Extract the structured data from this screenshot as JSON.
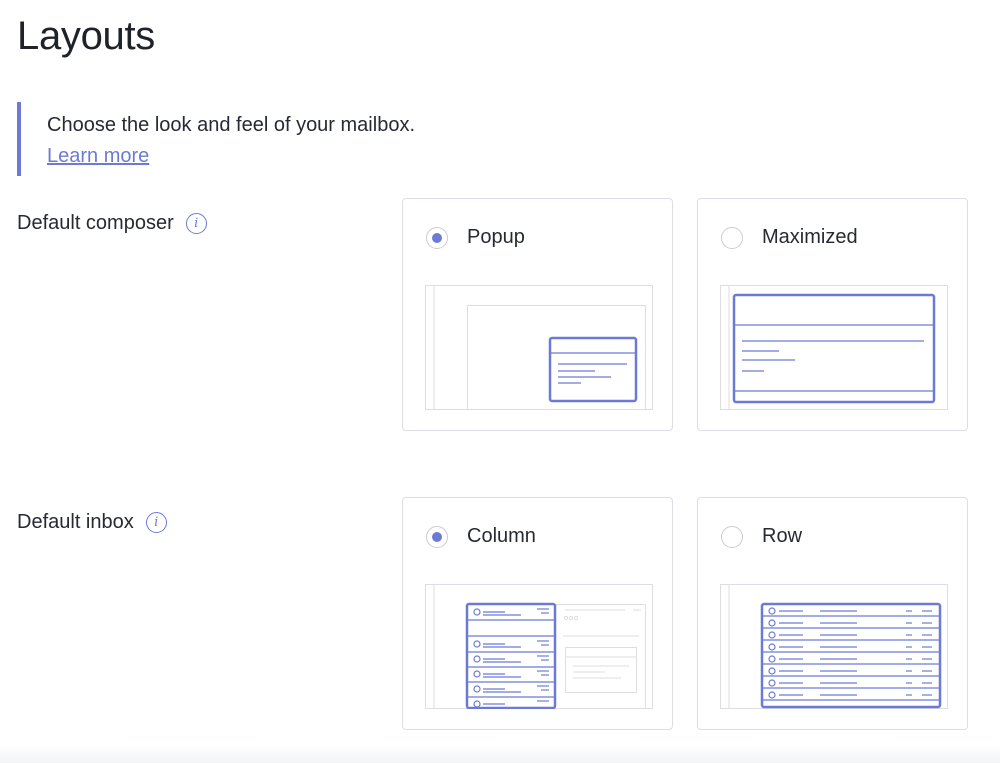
{
  "page": {
    "title": "Layouts"
  },
  "info": {
    "description": "Choose the look and feel of your mailbox.",
    "link_label": "Learn more"
  },
  "settings": {
    "composer": {
      "label": "Default composer",
      "info_icon": "i",
      "options": [
        {
          "label": "Popup",
          "selected": true
        },
        {
          "label": "Maximized",
          "selected": false
        }
      ]
    },
    "inbox": {
      "label": "Default inbox",
      "info_icon": "i",
      "options": [
        {
          "label": "Column",
          "selected": true
        },
        {
          "label": "Row",
          "selected": false
        }
      ]
    }
  },
  "colors": {
    "accent": "#6d7ad5",
    "text": "#262a33",
    "card_border": "#dcdee3",
    "preview_gray": "#dcdee3"
  }
}
